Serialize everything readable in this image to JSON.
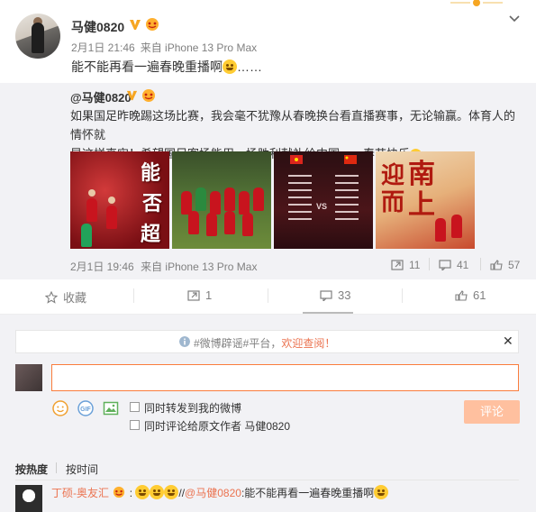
{
  "post": {
    "username": "马健0820",
    "date": "2月1日 21:46",
    "via": "来自 iPhone 13 Pro Max",
    "content": "能不能再看一遍春晚重播啊",
    "content_suffix": "……"
  },
  "repost": {
    "username": "@马健0820",
    "text_line1": "如果国足昨晚踢这场比赛，我会毫不犹豫从春晚换台看直播赛事，无论输赢。体育人的情怀就",
    "text_line2": "是这样真实！希望国足客场能用一场胜利献礼给中国",
    "text_line2_cn": "CN",
    "text_line2_end": "，春节快乐",
    "images": [
      {
        "alt": "能否超",
        "chars": [
          "能",
          "否",
          "超"
        ]
      },
      {
        "alt": "team-photo"
      },
      {
        "alt": "lineup-sheet",
        "caption": "VS"
      },
      {
        "alt": "迎南而上",
        "chars": [
          "迎",
          "南",
          "而",
          "上"
        ]
      }
    ],
    "date": "2月1日 19:46",
    "via": "来自 iPhone 13 Pro Max",
    "reposts": "11",
    "comments": "41",
    "likes": "57"
  },
  "actions": {
    "favorite": "收藏",
    "repost": "1",
    "comment": "33",
    "like": "61"
  },
  "notice": {
    "text": "#微博辟谣#平台，",
    "link": "欢迎查阅！"
  },
  "compose": {
    "placeholder": "",
    "option_forward": "同时转发到我的微博",
    "option_comment_origin": "同时评论给原文作者 马健0820",
    "submit": "评论"
  },
  "sort": {
    "by_hot": "按热度",
    "by_time": "按时间"
  },
  "comment": {
    "user": "丁硕-奥友汇",
    "sep": "//",
    "mention": "@马健0820",
    "text": ":能不能再看一遍春晚重播啊"
  },
  "colors": {
    "accent": "#eb7350",
    "submit_bg": "#ffc09f",
    "input_border": "#fa7d3c"
  }
}
